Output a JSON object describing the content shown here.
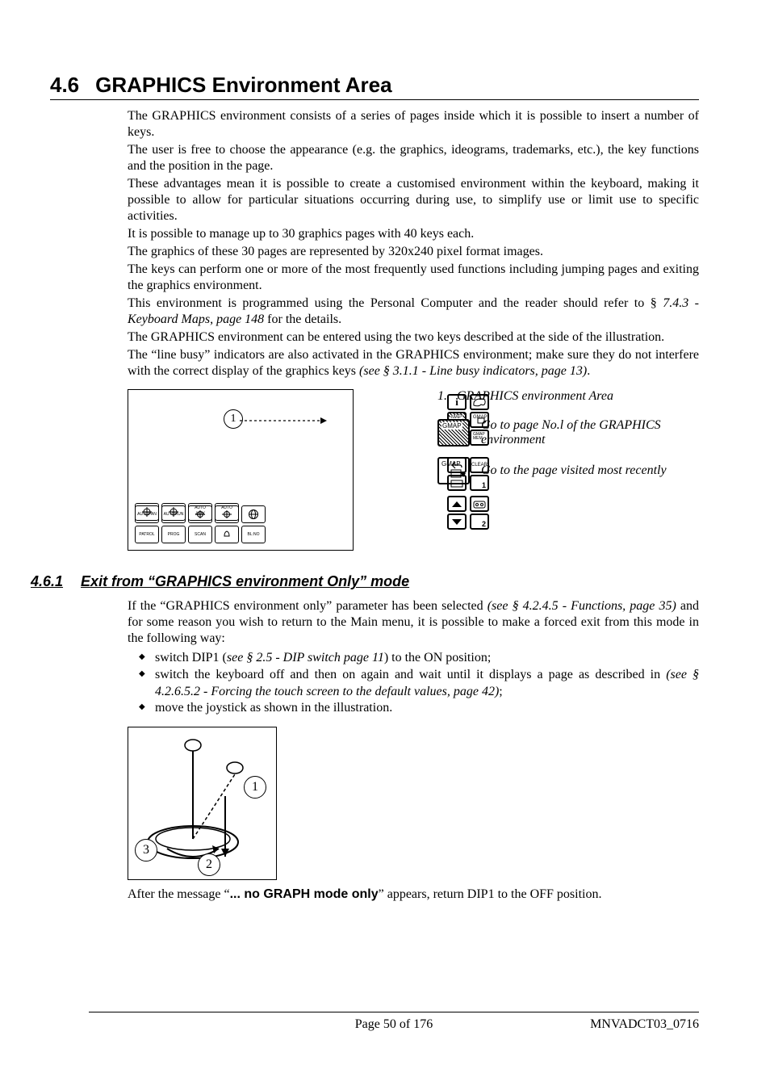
{
  "section": {
    "num": "4.6",
    "title": "GRAPHICS Environment Area"
  },
  "para": {
    "p1": "The GRAPHICS environment consists of a series of pages inside which it is possible to insert a number of keys.",
    "p2": "The user is free to choose the appearance (e.g. the graphics, ideograms, trademarks, etc.), the key functions and the position in the page.",
    "p3": "These advantages mean it is possible to create a customised environment within the keyboard, making it possible to allow for particular situations occurring during use, to simplify use or limit use to specific activities.",
    "p4": "It is possible to manage up to 30 graphics pages with 40 keys each.",
    "p5": "The graphics of these 30 pages are represented by 320x240 pixel format images.",
    "p6": "The keys can perform one or more of the most frequently used functions including jumping pages and exiting the graphics environment.",
    "p7a": "This environment is programmed using the Personal Computer and the reader should refer to § ",
    "p7b": "7.4.3 - Keyboard Maps, page  148",
    "p7c": " for the details.",
    "p8": "The GRAPHICS environment can be entered using the two keys described at the side of the illustration.",
    "p9a": "The “line busy” indicators are also activated in the GRAPHICS environment; make sure they do not interfere with the correct display of the graphics keys  ",
    "p9b": "(see § 3.1.1 - Line busy indicators, page 13)",
    "p9c": "."
  },
  "fig": {
    "callout1_num": "1.",
    "callout1": "GRAPHICS environment Area",
    "icon1_label": "GMAP",
    "icon2_label": "GMAP",
    "callout2": "Go to page No.l of the GRAPHICS environment",
    "callout3": "Go to the page visited most recently",
    "panel_labels": {
      "map": "MAP",
      "gmap": "GMAP",
      "gmap_mem": "GMAP MEM",
      "clear": "CLEAR"
    },
    "bottom_keys": [
      "AUTOPAN",
      "AUTORUN",
      "AUX",
      "PATROL",
      "PROG",
      "SCAN",
      "BL:NO"
    ],
    "auto_label": "AUTO",
    "page1": "1",
    "page2": "2",
    "circle1": "1"
  },
  "subsection": {
    "num": "4.6.1",
    "title": "Exit from “GRAPHICS environment Only” mode"
  },
  "sub": {
    "p1a": "If the “GRAPHICS environment only” parameter has been selected ",
    "p1b": "(see § 4.2.4.5 - Functions, page 35)",
    "p1c": " and for some reason you wish to return to the Main menu, it is possible to make a forced exit from this mode in the following way:",
    "b1a": "switch DIP1 (",
    "b1b": "see § 2.5 - DIP switch page 11",
    "b1c": ") to the ON position;",
    "b2a": "switch the keyboard off and then on again and wait until it displays a page as described in ",
    "b2b": "(see § 4.2.6.5.2 - Forcing the touch screen to the default values, page 42)",
    "b2c": ";",
    "b3": "move the joystick as shown in the illustration.",
    "after_a": "After the message “",
    "after_b": "... no GRAPH mode only",
    "after_c": "” appears, return DIP1 to the OFF position."
  },
  "joystick": {
    "n1": "1",
    "n2": "2",
    "n3": "3"
  },
  "footer": {
    "page": "Page 50 of 176",
    "doc": "MNVADCT03_0716"
  }
}
